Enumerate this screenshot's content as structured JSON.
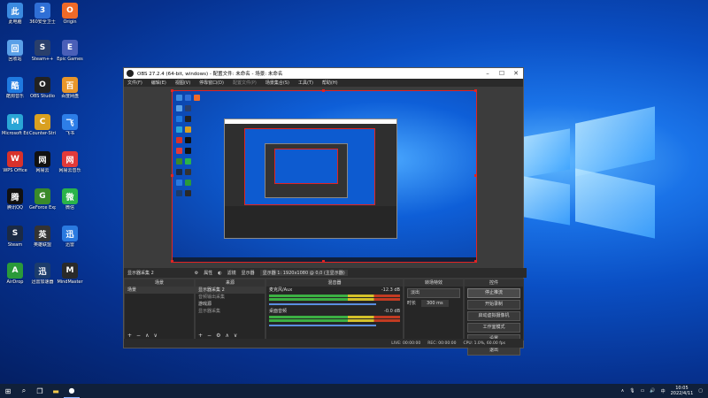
{
  "desktop_icons": [
    {
      "label": "此电脑",
      "color": "#3b8be0"
    },
    {
      "label": "360安全卫士",
      "color": "#2f6fd6"
    },
    {
      "label": "Origin",
      "color": "#f06a28"
    },
    {
      "label": "回收站",
      "color": "#5aa0e8"
    },
    {
      "label": "Steam++",
      "color": "#2a3f6b"
    },
    {
      "label": "Epic Games",
      "color": "#4a5fb8"
    },
    {
      "label": "酷狗音乐",
      "color": "#1f7ae0"
    },
    {
      "label": "OBS Studio",
      "color": "#222"
    },
    {
      "label": "百度网盘",
      "color": "#e8962a"
    },
    {
      "label": "Microsoft Edge",
      "color": "#2aa6d6"
    },
    {
      "label": "Counter-Strike",
      "color": "#d9a020"
    },
    {
      "label": "飞书",
      "color": "#2d7ee8"
    },
    {
      "label": "WPS Office",
      "color": "#d8312b"
    },
    {
      "label": "网易云",
      "color": "#111"
    },
    {
      "label": "网易云音乐",
      "color": "#e23a3a"
    },
    {
      "label": "腾讯QQ",
      "color": "#111"
    },
    {
      "label": "GeForce Experience",
      "color": "#3a8a2a"
    },
    {
      "label": "微信",
      "color": "#2ab34a"
    },
    {
      "label": "Steam",
      "color": "#1b2a44"
    },
    {
      "label": "英雄联盟",
      "color": "#333"
    },
    {
      "label": "迅雷",
      "color": "#2a7ae0"
    },
    {
      "label": "AirDrop",
      "color": "#2a9a3a"
    },
    {
      "label": "迅雷加速器",
      "color": "#1c3c6c"
    },
    {
      "label": "MindMaster",
      "color": "#2a2a2a"
    }
  ],
  "obs": {
    "title": "OBS 27.2.4 (64-bit, windows) - 配置文件: 未命名 - 场景: 未命名",
    "menu": [
      "文件(F)",
      "编辑(E)",
      "视图(V)",
      "停靠窗口(D)",
      "配置文件(P)",
      "场景集合(S)",
      "工具(T)",
      "帮助(H)"
    ],
    "controls": [
      "显示器采集 2",
      "属性",
      "滤镜",
      "显示器",
      "显示器 1: 1920x1080 @ 0,0 (主显示器)"
    ],
    "scenes_header": "场景",
    "scenes": [
      "场景"
    ],
    "sources_header": "来源",
    "sources": [
      "显示器采集 2",
      "音频输出采集",
      "游戏源",
      "显示器采集"
    ],
    "mixer_header": "混音器",
    "mixer": [
      {
        "name": "麦克风/Aux",
        "db": "-12.3 dB"
      },
      {
        "name": "桌面音频",
        "db": "-0.0 dB"
      }
    ],
    "transition_header": "转场特效",
    "transition_type": "淡出",
    "duration_label": "时长",
    "duration": "300 ms",
    "controls_header": "控件",
    "buttons": [
      "停止推流",
      "开始录制",
      "启动虚拟摄像机",
      "工作室模式",
      "设置",
      "退出"
    ],
    "status": [
      "LIVE: 00:00:00",
      "REC: 00:00:00",
      "CPU: 1.0%, 60.00 fps"
    ]
  },
  "taskbar": {
    "time": "10:05",
    "date": "2022/4/11"
  }
}
